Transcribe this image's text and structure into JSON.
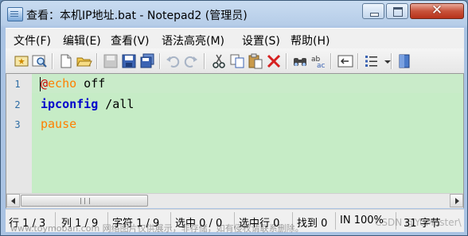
{
  "window": {
    "title": "查看：本机IP地址.bat - Notepad2 (管理员)",
    "close_glyph": "✕"
  },
  "menu": [
    "文件(F)",
    "编辑(E)",
    "查看(V)",
    "语法高亮(M)",
    "设置(S)",
    "帮助(H)"
  ],
  "editor": {
    "line_numbers": [
      "1",
      "2",
      "3"
    ],
    "lines": [
      {
        "at": "@",
        "keyword": "echo",
        "rest": " off"
      },
      {
        "keyword": "ipconfig",
        "rest": " /all"
      },
      {
        "keyword": "pause",
        "rest": ""
      }
    ],
    "background_color": "#c6ecc6"
  },
  "statusbar": {
    "line": "行 1 / 3",
    "col": "列 1 / 9",
    "chars": "字符 1 / 9",
    "sel": "选中 0 / 0",
    "sel_lines": "选中行 0",
    "found": "找到 0",
    "zoom": "IN 100%",
    "bytes": "31 字节"
  },
  "watermark": {
    "text": "www.toymoban.com 网络图片仅供展示，非存储，如有侵权请联系删除。",
    "credit": "CSDN @YuMaster\\"
  }
}
